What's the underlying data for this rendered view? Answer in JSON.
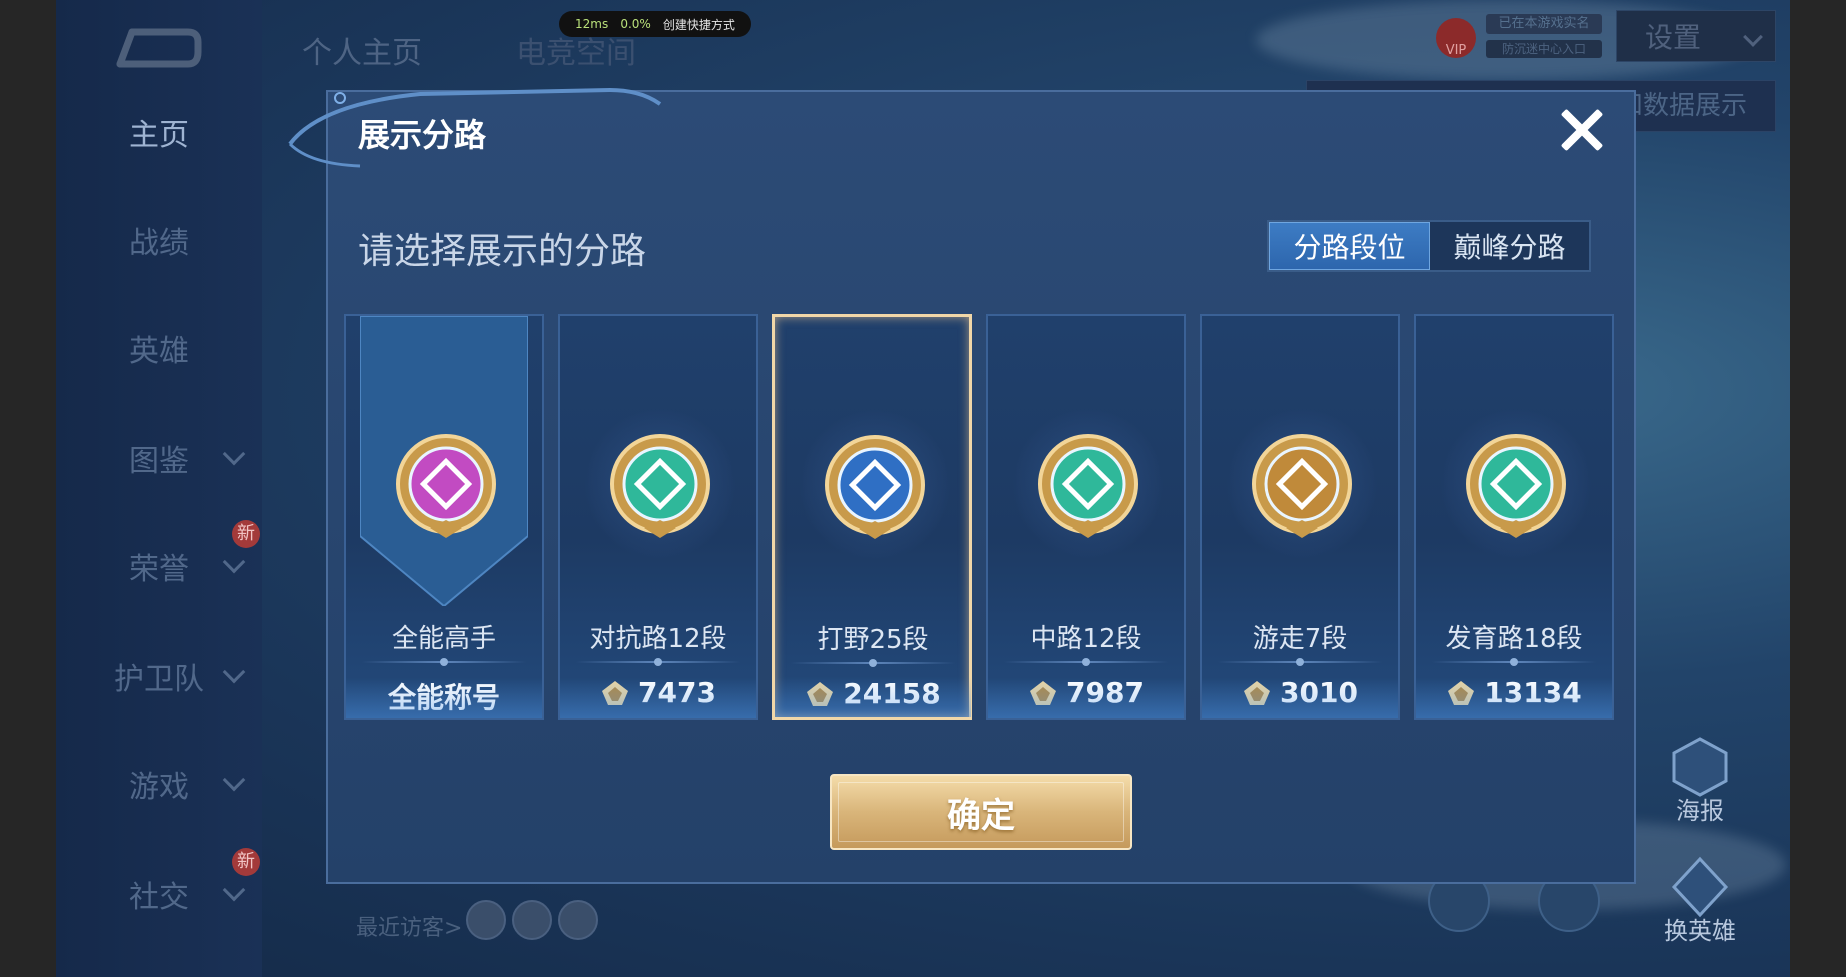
{
  "overlay": {
    "latency": "12ms",
    "cpu": "0.0%",
    "shortcut_label": "创建快捷方式"
  },
  "header": {
    "title": "个人主页",
    "secondary_title": "电竞空间",
    "settings_label": "设置",
    "auth_top": "已在本游戏实名",
    "auth_bottom": "防沉迷中心入口",
    "data_tab_label": "荣誉和数据展示",
    "vip_label": "VIP"
  },
  "sidebar": {
    "items": [
      {
        "label": "主页",
        "active": true,
        "expandable": false,
        "badge": ""
      },
      {
        "label": "战绩",
        "active": false,
        "expandable": false,
        "badge": ""
      },
      {
        "label": "英雄",
        "active": false,
        "expandable": false,
        "badge": ""
      },
      {
        "label": "图鉴",
        "active": false,
        "expandable": true,
        "badge": ""
      },
      {
        "label": "荣誉",
        "active": false,
        "expandable": true,
        "badge": "新"
      },
      {
        "label": "护卫队",
        "active": false,
        "expandable": true,
        "badge": ""
      },
      {
        "label": "游戏",
        "active": false,
        "expandable": true,
        "badge": ""
      },
      {
        "label": "社交",
        "active": false,
        "expandable": true,
        "badge": "新"
      }
    ]
  },
  "bottom": {
    "recent_visitors": "最近访客>",
    "poster_label": "海报",
    "switch_hero_label": "换英雄"
  },
  "modal": {
    "title": "展示分路",
    "subtitle": "请选择展示的分路",
    "toggle": [
      {
        "label": "分路段位",
        "active": true
      },
      {
        "label": "巅峰分路",
        "active": false
      }
    ],
    "cards": [
      {
        "name": "全能高手",
        "score": "全能称号",
        "emblem": "all-round-emblem-icon",
        "color": "#c24bc2",
        "selected": false,
        "has_score_icon": false
      },
      {
        "name": "对抗路12段",
        "score": "7473",
        "emblem": "clash-lane-emblem-icon",
        "color": "#2fb89a",
        "selected": false,
        "has_score_icon": true
      },
      {
        "name": "打野25段",
        "score": "24158",
        "emblem": "jungle-emblem-icon",
        "color": "#2f6fc4",
        "selected": true,
        "has_score_icon": true
      },
      {
        "name": "中路12段",
        "score": "7987",
        "emblem": "mid-lane-emblem-icon",
        "color": "#2fb89a",
        "selected": false,
        "has_score_icon": true
      },
      {
        "name": "游走7段",
        "score": "3010",
        "emblem": "roam-emblem-icon",
        "color": "#c08a3a",
        "selected": false,
        "has_score_icon": true
      },
      {
        "name": "发育路18段",
        "score": "13134",
        "emblem": "farm-lane-emblem-icon",
        "color": "#2fb89a",
        "selected": false,
        "has_score_icon": true
      }
    ],
    "confirm_label": "确定"
  }
}
